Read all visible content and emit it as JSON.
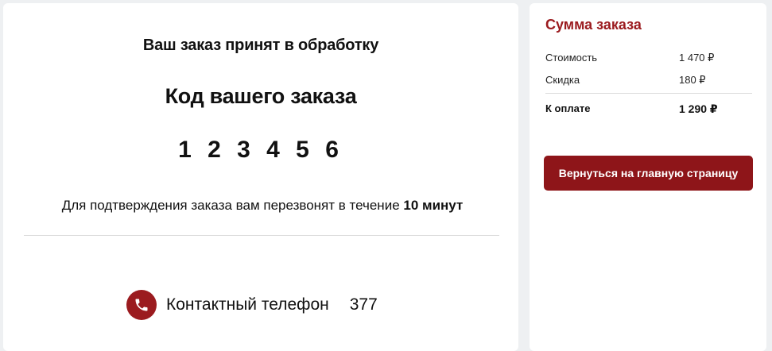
{
  "order": {
    "status_text": "Ваш заказ принят в обработку",
    "code_title": "Код вашего заказа",
    "code_value": "1 2 3 4 5 6",
    "confirm_text": "Для подтверждения заказа вам перезвонят в течение ",
    "confirm_time": "10 минут",
    "contact_label": "Контактный телефон",
    "contact_value": "377",
    "contact_icon": "phone-icon"
  },
  "summary": {
    "title": "Сумма заказа",
    "rows": [
      {
        "label": "Стоимость",
        "value": "1 470 ₽"
      },
      {
        "label": "Скидка",
        "value": "180 ₽"
      }
    ],
    "total": {
      "label": "К оплате",
      "value": "1 290 ₽"
    },
    "button_label": "Вернуться на главную страницу"
  },
  "colors": {
    "accent": "#9b1b1f",
    "button": "#8e1519",
    "background": "#eef0f2",
    "card": "#ffffff"
  }
}
